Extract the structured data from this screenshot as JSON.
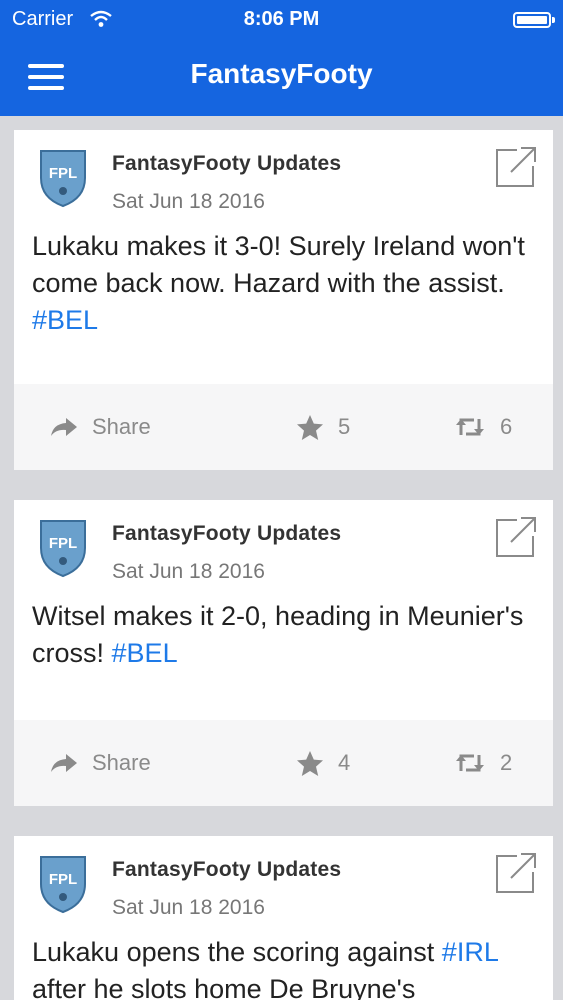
{
  "status_bar": {
    "carrier": "Carrier",
    "time": "8:06 PM"
  },
  "header": {
    "title": "FantasyFooty"
  },
  "colors": {
    "header": "#1565e0",
    "hashtag": "#1e7ae8",
    "background": "#d7d8dc"
  },
  "posts": [
    {
      "author": "FantasyFooty Updates",
      "date": "Sat Jun 18 2016",
      "text_plain": "Lukaku makes it 3-0! Surely Ireland won't come back now. Hazard with the assist.",
      "hashtag": "#BEL",
      "share_label": "Share",
      "favorites": "5",
      "retweets": "6"
    },
    {
      "author": "FantasyFooty Updates",
      "date": "Sat Jun 18 2016",
      "text_plain": "Witsel makes it 2-0, heading in Meunier's cross!",
      "hashtag": "#BEL",
      "share_label": "Share",
      "favorites": "4",
      "retweets": "2"
    },
    {
      "author": "FantasyFooty Updates",
      "date": "Sat Jun 18 2016",
      "text_prefix": "Lukaku opens the scoring against",
      "hashtag": "#IRL",
      "text_suffix": "after he slots home De Bruyne's"
    }
  ]
}
